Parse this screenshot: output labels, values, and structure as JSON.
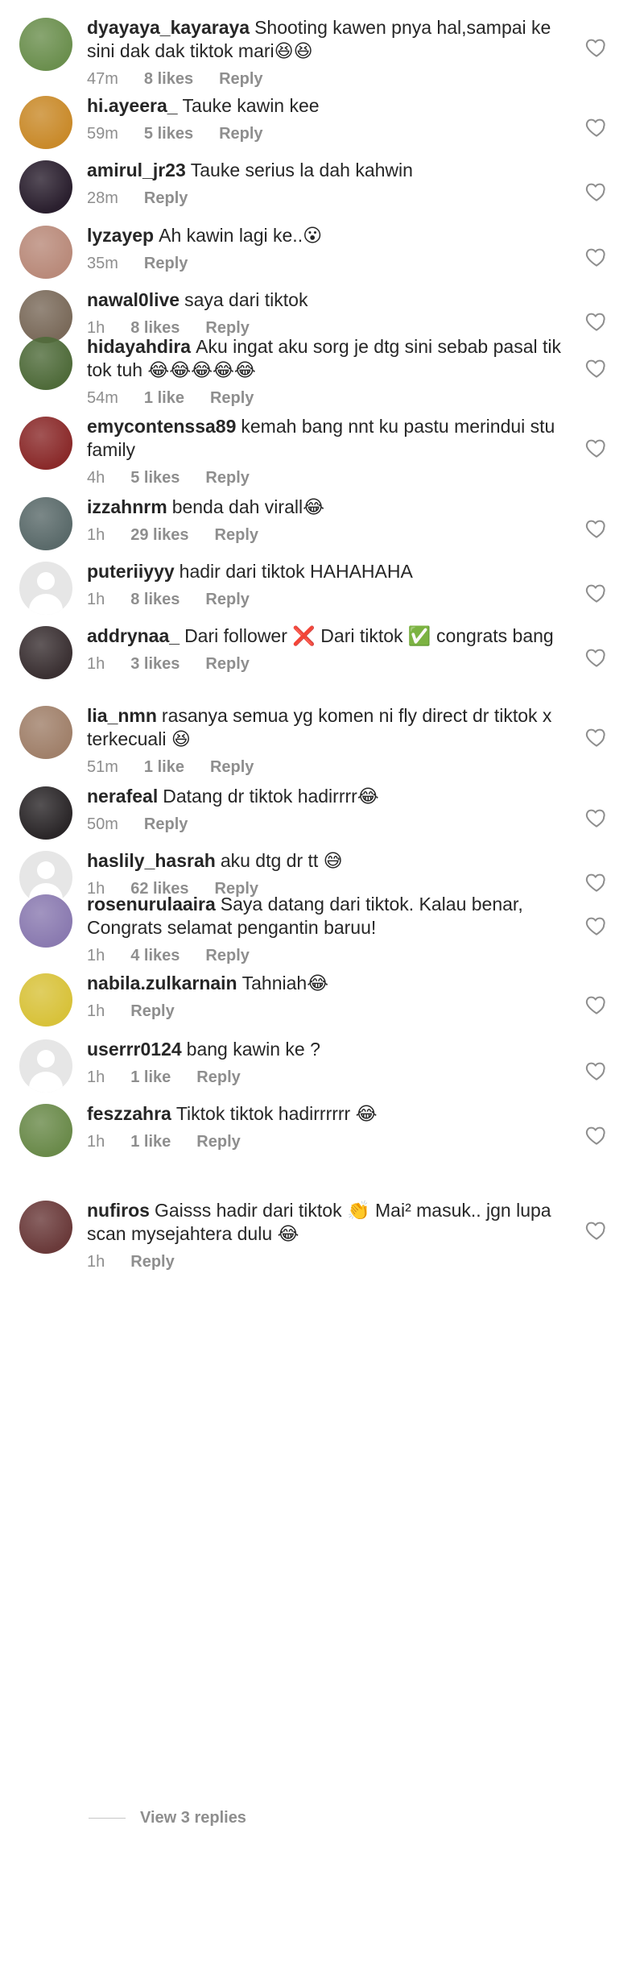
{
  "comments": [
    {
      "username": "dyayaya_kayaraya",
      "text": "Shooting kawen pnya hal,sampai ke sini dak dak tiktok mari😆😆",
      "time": "47m",
      "likes": "8 likes",
      "reply": "Reply",
      "avatar_color": "#6b8f4e"
    },
    {
      "username": "hi.ayeera_",
      "text": "Tauke kawin kee",
      "time": "59m",
      "likes": "5 likes",
      "reply": "Reply",
      "avatar_color": "#c98a2a"
    },
    {
      "username": "amirul_jr23",
      "text": "Tauke serius la dah kahwin",
      "time": "28m",
      "likes": "",
      "reply": "Reply",
      "avatar_color": "#2a1f2e"
    },
    {
      "username": "lyzayep",
      "text": "Ah kawin lagi ke..😮",
      "time": "35m",
      "likes": "",
      "reply": "Reply",
      "avatar_color": "#b98a7a"
    },
    {
      "username": "nawal0live",
      "text": "saya dari tiktok",
      "time": "1h",
      "likes": "8 likes",
      "reply": "Reply",
      "avatar_color": "#7a6a5a"
    },
    {
      "username": "hidayahdira",
      "text": "Aku ingat aku sorg je dtg sini sebab pasal tik tok tuh 😂😂😂😂😂",
      "time": "54m",
      "likes": "1 like",
      "reply": "Reply",
      "avatar_color": "#4f6b3a"
    },
    {
      "username": "emycontenssa89",
      "text": "kemah bang nnt ku pastu merindui stu family",
      "time": "4h",
      "likes": "5 likes",
      "reply": "Reply",
      "avatar_color": "#8a2a2a"
    },
    {
      "username": "izzahnrm",
      "text": "benda dah virall😂",
      "time": "1h",
      "likes": "29 likes",
      "reply": "Reply",
      "avatar_color": "#5a6a6a"
    },
    {
      "username": "puteriiyyy",
      "text": "hadir dari tiktok HAHAHAHA",
      "time": "1h",
      "likes": "8 likes",
      "reply": "Reply",
      "avatar_color": ""
    },
    {
      "username": "addrynaa_",
      "text": "Dari follower ❌ Dari tiktok ✅ congrats bang",
      "time": "1h",
      "likes": "3 likes",
      "reply": "Reply",
      "avatar_color": "#3a3032"
    },
    {
      "username": "lia_nmn",
      "text": "rasanya semua yg komen ni fly direct dr tiktok x terkecuali 😆",
      "time": "51m",
      "likes": "1 like",
      "reply": "Reply",
      "avatar_color": "#a0806a"
    },
    {
      "username": "nerafeal",
      "text": "Datang dr tiktok hadirrrr😂",
      "time": "50m",
      "likes": "",
      "reply": "Reply",
      "avatar_color": "#2a2628"
    },
    {
      "username": "haslily_hasrah",
      "text": "aku dtg dr tt 😅",
      "time": "1h",
      "likes": "62 likes",
      "reply": "Reply",
      "avatar_color": ""
    },
    {
      "username": "rosenurulaaira",
      "text": "Saya datang dari tiktok. Kalau benar, Congrats selamat pengantin baruu!",
      "time": "1h",
      "likes": "4 likes",
      "reply": "Reply",
      "avatar_color": "#8a7ab0"
    },
    {
      "username": "nabila.zulkarnain",
      "text": "Tahniah😂",
      "time": "1h",
      "likes": "",
      "reply": "Reply",
      "avatar_color": "#d8c23a"
    },
    {
      "username": "userrr0124",
      "text": "bang kawin ke ?",
      "time": "1h",
      "likes": "1 like",
      "reply": "Reply",
      "avatar_color": ""
    },
    {
      "username": "feszzahra",
      "text": "Tiktok tiktok hadirrrrrr 😂",
      "time": "1h",
      "likes": "1 like",
      "reply": "Reply",
      "avatar_color": "#6a8a4a"
    },
    {
      "username": "nufiros",
      "text": "Gaisss hadir dari tiktok 👏 Mai² masuk.. jgn lupa scan mysejahtera dulu 😂",
      "time": "1h",
      "likes": "",
      "reply": "Reply",
      "avatar_color": "#6a3a3a"
    }
  ],
  "view_replies_label": "View 3 replies",
  "icons": {
    "like": "heart-outline-icon"
  }
}
